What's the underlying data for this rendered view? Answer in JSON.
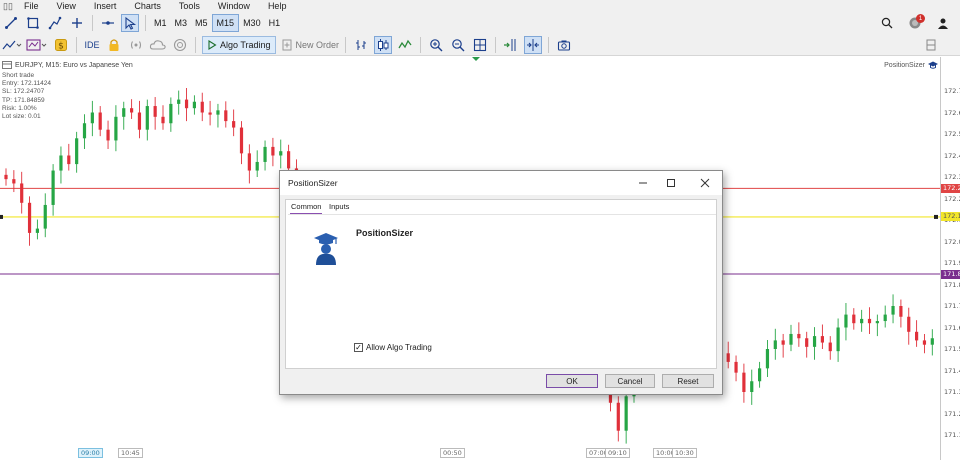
{
  "menubar": {
    "items": [
      "File",
      "View",
      "Insert",
      "Charts",
      "Tools",
      "Window",
      "Help"
    ]
  },
  "toolbar1": {
    "timeframes": [
      "M1",
      "M3",
      "M5",
      "M15",
      "M30",
      "H1"
    ],
    "active_timeframe": "M15",
    "notification_count": "1"
  },
  "toolbar2": {
    "ide_label": "IDE",
    "algo_trading_label": "Algo Trading",
    "new_order_label": "New Order"
  },
  "chart": {
    "symbol_line": "EURJPY, M15:  Euro vs Japanese Yen",
    "ea_label": "PositionSizer",
    "info_lines": [
      "Short trade",
      "Entry:  172.11424",
      "SL:  172.24707",
      "TP:  171.84859",
      "Risk:  1.00%",
      "Lot size:  0.01"
    ],
    "price_axis": [
      "172.7",
      "172.6",
      "172.5",
      "172.4",
      "172.3",
      "172.2",
      "172.1",
      "172.0",
      "171.9",
      "171.8",
      "171.7",
      "171.6",
      "171.5",
      "171.4",
      "171.3",
      "171.2",
      "171.1"
    ],
    "price_tags": {
      "sl": "172.2",
      "entry": "172.1",
      "tp": "171.8"
    },
    "time_axis": [
      "09:00",
      "10:45",
      "00:50",
      "07:00",
      "09:10",
      "10:00",
      "10:30"
    ],
    "colors": {
      "bull": "#26a645",
      "bear": "#e0303a",
      "sl_line": "#e04545",
      "entry_line": "#f2e62a",
      "tp_line": "#7a2e8e"
    }
  },
  "dialog": {
    "title": "PositionSizer",
    "tabs": [
      "Common",
      "Inputs"
    ],
    "ea_name": "PositionSizer",
    "allow_algo_label": "Allow Algo Trading",
    "allow_algo_checked": true,
    "buttons": {
      "ok": "OK",
      "cancel": "Cancel",
      "reset": "Reset"
    }
  }
}
